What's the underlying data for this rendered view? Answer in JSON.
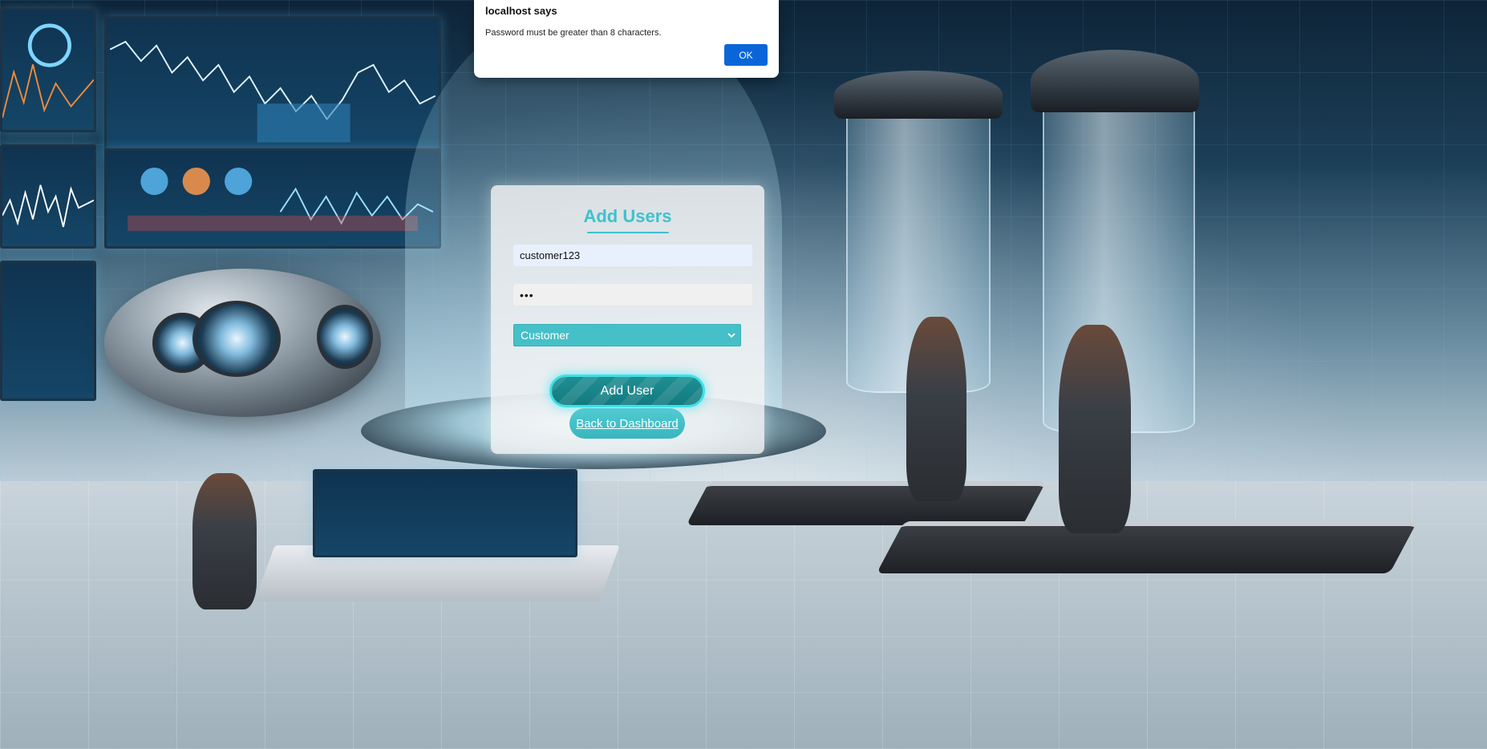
{
  "alert": {
    "title": "localhost says",
    "message": "Password must be greater than 8 characters.",
    "ok_label": "OK"
  },
  "form": {
    "title": "Add Users",
    "username_value": "customer123",
    "password_value": "•••",
    "role_selected": "Customer",
    "submit_label": "Add User",
    "back_label": "Back to Dashboard"
  },
  "colors": {
    "accent": "#3ec1cc",
    "select_bg": "#45c0c8",
    "button_bg": "#1f8f93",
    "button_glow": "#3ee0e8",
    "alert_ok_bg": "#0a66d8"
  }
}
